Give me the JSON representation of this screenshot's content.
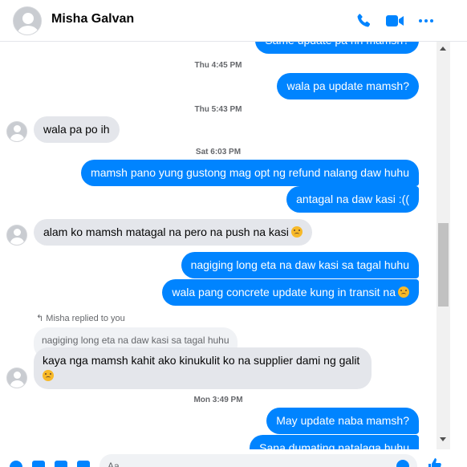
{
  "header": {
    "contact_name": "Misha Galvan",
    "icons": [
      "phone-icon",
      "video-camera-icon",
      "more-options-icon"
    ],
    "accent_color": "#0084ff"
  },
  "messages": {
    "m0_out": "Same update pa rin mamsh?",
    "ts1": "Thu 4:45 PM",
    "m1_out": "wala pa update mamsh?",
    "ts2": "Thu 5:43 PM",
    "m2_in": "wala pa po ih",
    "ts3": "Sat 6:03 PM",
    "m3_out": "mamsh pano yung gustong mag opt ng refund nalang daw huhu",
    "m4_out": "antagal na daw kasi :((",
    "m5_in": "alam ko mamsh matagal na pero na push na kasi",
    "m6_out": "nagiging long eta na daw kasi sa tagal huhu",
    "m7_out": "wala pang concrete update kung in transit na",
    "replied_label": "Misha replied to you",
    "reply_quote": "nagiging long eta na daw kasi sa tagal huhu",
    "m8_in_line1": "kaya nga mamsh kahit ako kinukulit ko na supplier dami ng galit",
    "ts4": "Mon 3:49 PM",
    "m9_out": "May update naba mamsh?",
    "m10_out": "Sana dumating natalaga huhu"
  },
  "composer": {
    "placeholder": "Aa",
    "icons": [
      "add-icon",
      "image-icon",
      "sticker-icon",
      "gif-icon",
      "emoji-icon",
      "like-icon"
    ]
  }
}
